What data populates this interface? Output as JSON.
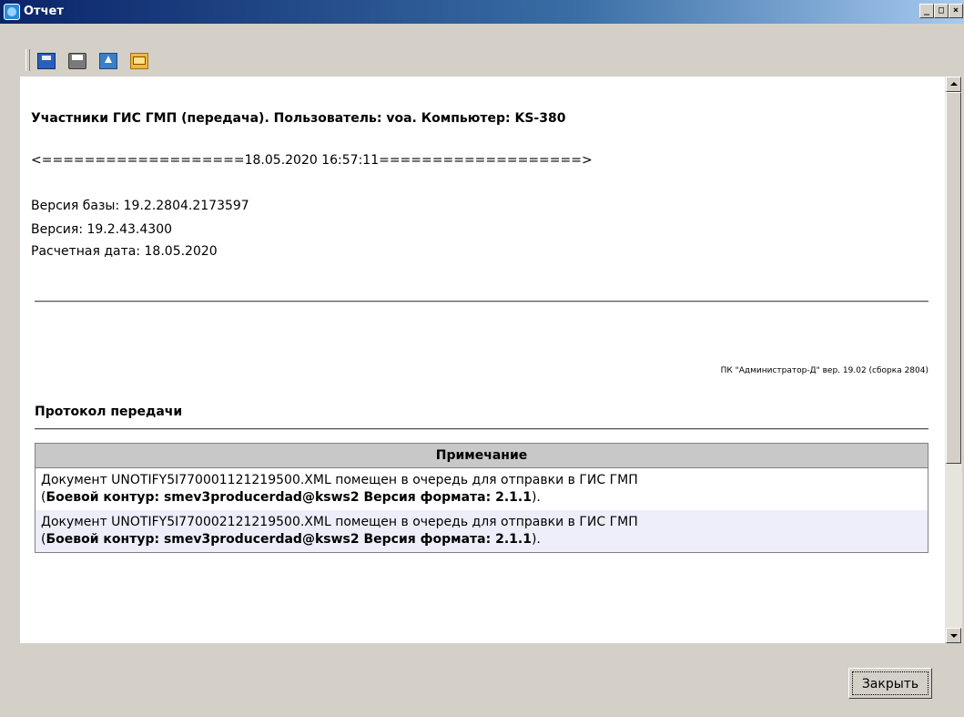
{
  "window": {
    "title": "Отчет",
    "minimize": "_",
    "maximize": "□",
    "close": "×"
  },
  "toolbar": {
    "icons": [
      "save-icon",
      "print-icon",
      "export-icon",
      "mail-icon"
    ]
  },
  "report": {
    "heading": "Участники ГИС ГМП (передача). Пользователь: voa. Компьютер: KS-380",
    "separator_line": "<===================18.05.2020 16:57:11===================>",
    "db_version": "Версия базы: 19.2.2804.2173597",
    "version": "Версия: 19.2.43.4300",
    "calc_date": "Расчетная дата: 18.05.2020",
    "product_note": "ПК \"Администратор-Д\" вер. 19.02 (сборка 2804)",
    "protocol_title": "Протокол передачи",
    "table_header": "Примечание",
    "rows": [
      {
        "line1": "Документ UNOTIFY5I770001121219500.XML помещен в очередь для отправки в ГИС ГМП",
        "open": "(",
        "bold": "Боевой контур: smev3producerdad@ksws2 Версия формата: 2.1.1",
        "close": ")."
      },
      {
        "line1": "Документ UNOTIFY5I770002121219500.XML помещен в очередь для отправки в ГИС ГМП",
        "open": "(",
        "bold": "Боевой контур: smev3producerdad@ksws2 Версия формата: 2.1.1",
        "close": ")."
      }
    ]
  },
  "buttons": {
    "close": "Закрыть"
  }
}
